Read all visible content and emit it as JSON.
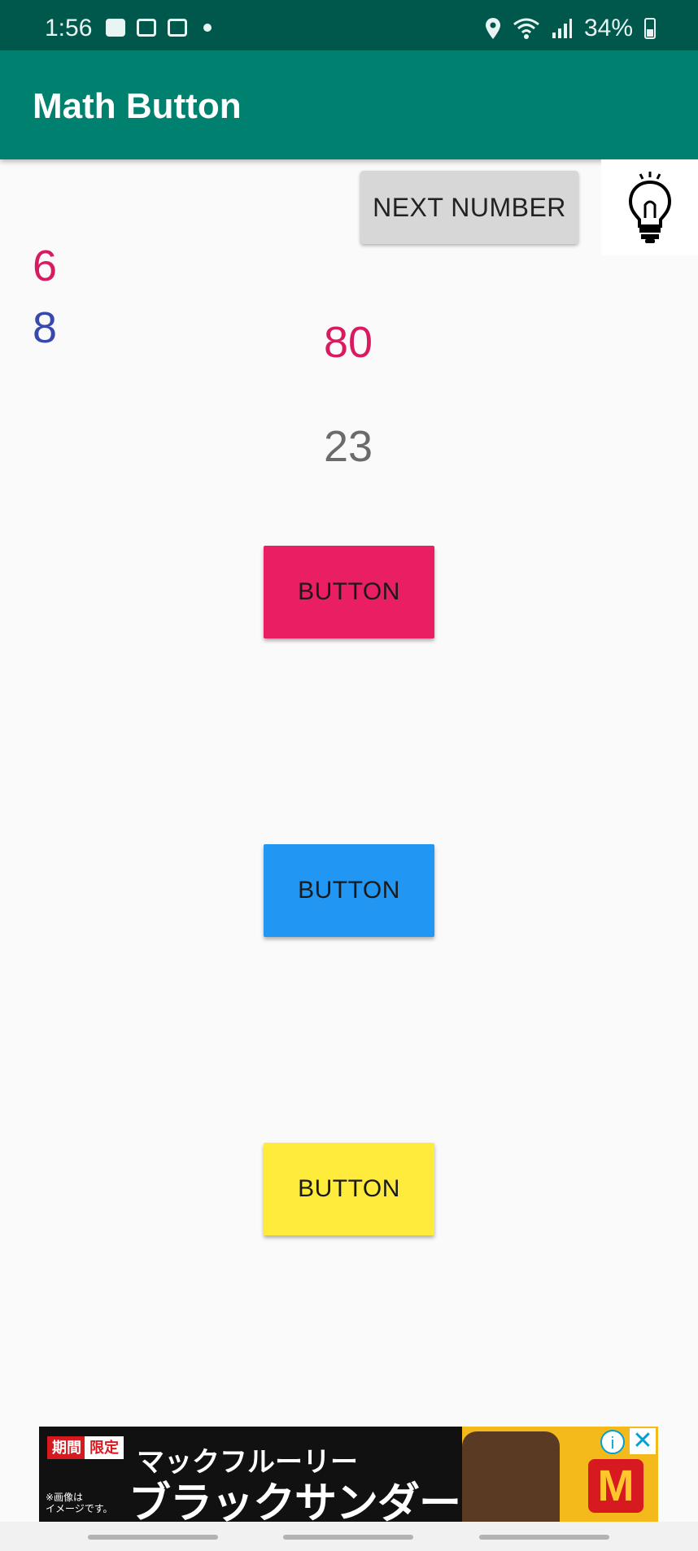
{
  "status_bar": {
    "time": "1:56",
    "left_icons": [
      "game-icon",
      "gallery-icon",
      "calendar-icon",
      "notification-dot-icon"
    ],
    "right_icons": [
      "location-icon",
      "wifi-icon",
      "signal-icon"
    ],
    "battery_text": "34%",
    "background": "#00574b"
  },
  "app_bar": {
    "title": "Math Button",
    "background": "#00806f"
  },
  "toolbar": {
    "next_label": "NEXT NUMBER",
    "hint_icon": "lightbulb-icon"
  },
  "numbers": {
    "a": "6",
    "b": "8",
    "target": "80",
    "current": "23",
    "colors": {
      "a": "#d81b60",
      "b": "#3949ab",
      "target": "#d81b60",
      "current": "#6b6b6b"
    }
  },
  "buttons": [
    {
      "label": "BUTTON",
      "color": "#e91e63"
    },
    {
      "label": "BUTTON",
      "color": "#2196f3"
    },
    {
      "label": "BUTTON",
      "color": "#ffeb3b"
    }
  ],
  "ad": {
    "tag1": "期間",
    "tag2": "限定",
    "line1": "マックフルーリー",
    "line2": "ブラックサンダー",
    "small": "※画像は\nイメージです。",
    "info_icon": "info-icon",
    "close_icon": "close-icon"
  }
}
